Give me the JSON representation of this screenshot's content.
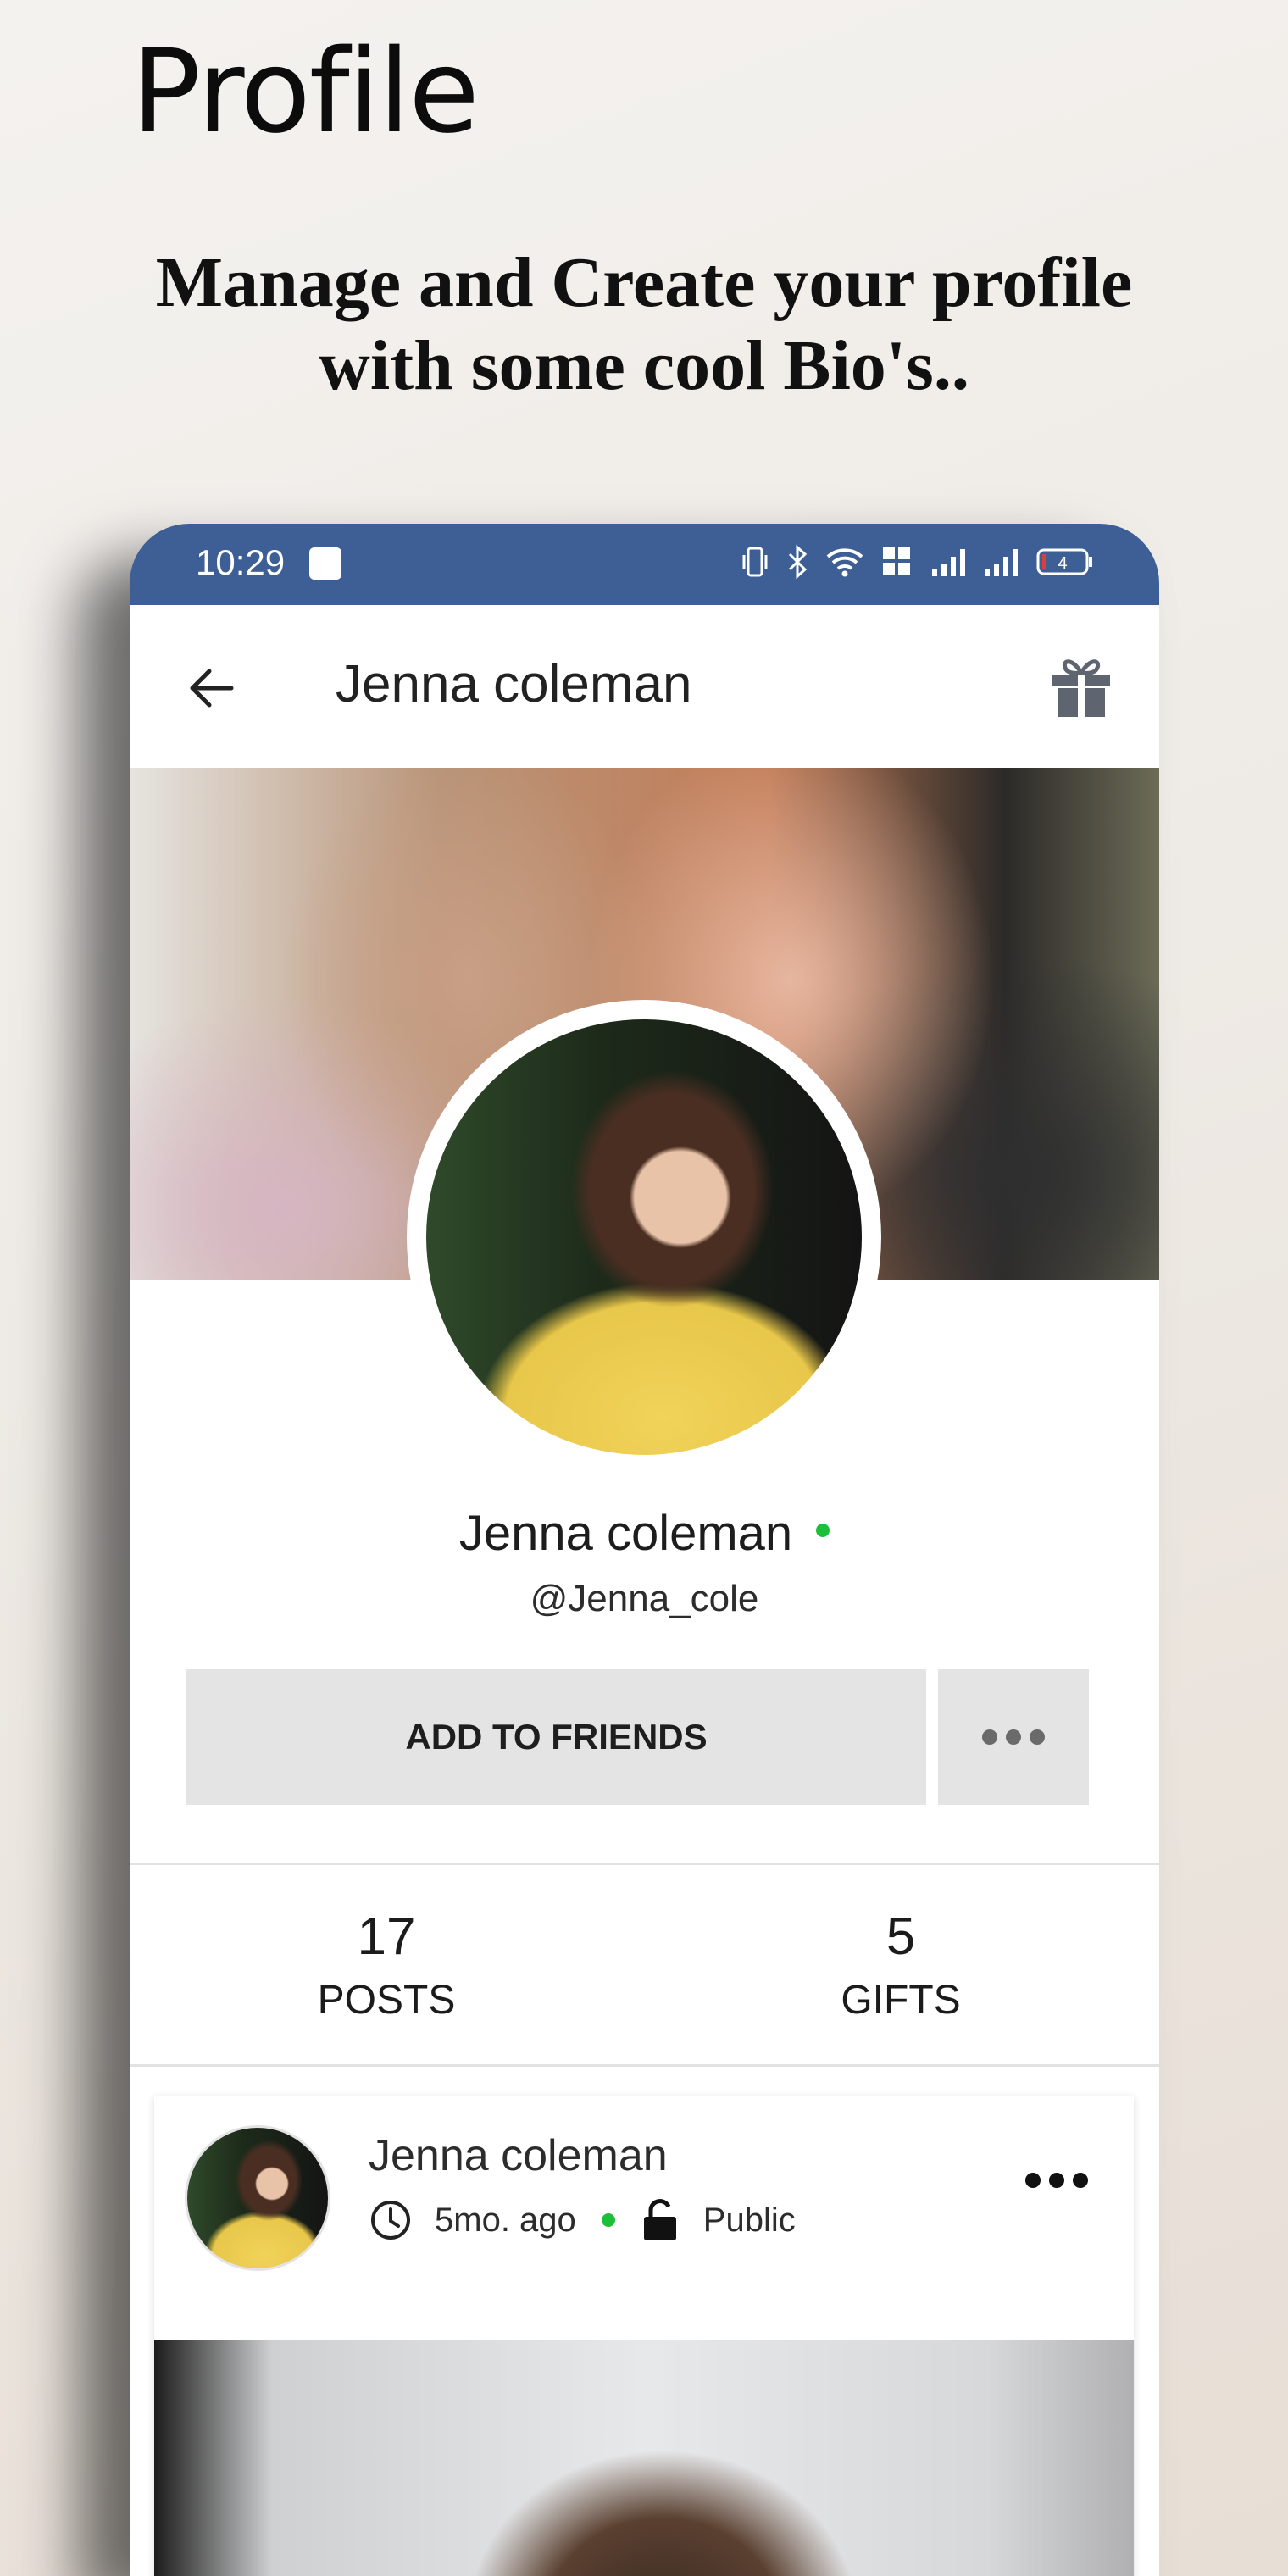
{
  "promo": {
    "title": "Profile",
    "subtitle_line1": "Manage and Create your profile",
    "subtitle_line2": "with some cool Bio's.."
  },
  "status_bar": {
    "time": "10:29",
    "battery": "4",
    "icons": [
      "app-notification-icon",
      "vibrate-icon",
      "bluetooth-icon",
      "wifi-icon",
      "volte-icon",
      "signal-icon",
      "signal-icon",
      "battery-icon"
    ]
  },
  "app_bar": {
    "title": "Jenna coleman",
    "back_icon": "back-arrow-icon",
    "gift_icon": "gift-icon"
  },
  "profile": {
    "name": "Jenna coleman",
    "handle": "@Jenna_cole",
    "online": true,
    "add_friends_label": "ADD TO FRIENDS",
    "more_icon": "more-horizontal-icon"
  },
  "stats": [
    {
      "value": "17",
      "label": "POSTS"
    },
    {
      "value": "5",
      "label": "GIFTS"
    }
  ],
  "post": {
    "author": "Jenna coleman",
    "time": "5mo. ago",
    "privacy": "Public"
  },
  "colors": {
    "status_bar": "#3e5f95",
    "online": "#1cbf3a",
    "button_bg": "#e4e4e4",
    "gift_icon": "#5e6470"
  }
}
